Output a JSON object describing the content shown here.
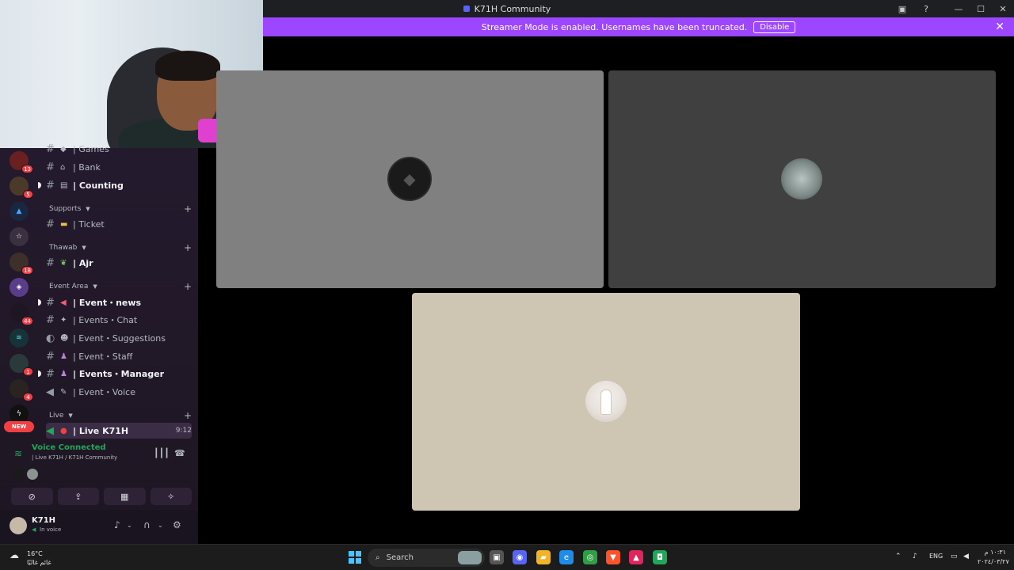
{
  "window": {
    "title": "K71H Community",
    "icons": {
      "inbox": "inbox-icon",
      "help": "help-icon",
      "minimize": "—",
      "maximize": "☐",
      "close": "✕"
    }
  },
  "banner": {
    "text": "Streamer Mode is enabled. Usernames have been truncated.",
    "button": "Disable",
    "close": "✕"
  },
  "guilds": {
    "badges": [
      "13",
      "5",
      "18",
      "44",
      "1",
      "4"
    ],
    "new_label": "NEW"
  },
  "channels": {
    "games": "| Games",
    "bank": "| Bank",
    "counting": "| Counting",
    "cat_supports": "Supports",
    "ticket": "| Ticket",
    "cat_thawab": "Thawab",
    "ajr": "| Ajr",
    "cat_event": "Event Area",
    "event_news": "| Event・news",
    "events_chat": "| Events・Chat",
    "event_suggestions": "| Event・Suggestions",
    "event_staff": "| Event・Staff",
    "events_manager": "| Events・Manager",
    "event_voice": "| Event・Voice",
    "cat_live": "Live",
    "live_channel": "| Live K71H",
    "live_time": "9:12"
  },
  "voice": {
    "title": "Voice Connected",
    "subtitle": "| Live K71H / K71H Community"
  },
  "user": {
    "name": "K71H",
    "status": "In voice"
  },
  "taskbar": {
    "temp": "16°C",
    "location": "غائم غالبًا",
    "search": "Search",
    "lang": "ENG",
    "time": "١٠:٣١ م",
    "date": "٢٠٢٤/٠٣/٢٧"
  }
}
